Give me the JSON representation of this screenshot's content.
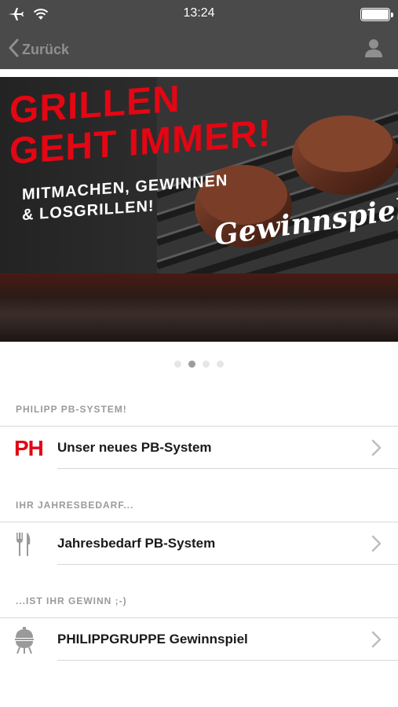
{
  "status_bar": {
    "time": "13:24",
    "icons": [
      "airplane-icon",
      "wifi-icon",
      "battery-icon"
    ]
  },
  "nav": {
    "back_label": "Zurück",
    "user_icon": "user-icon"
  },
  "banner": {
    "headline_line1": "GRILLEN",
    "headline_line2": "GEHT IMMER!",
    "sub_line1": "MITMACHEN, GEWINNEN",
    "sub_line2": "& LOSGRILLEN!",
    "script_text": "Gewinnspiel",
    "accent_color": "#e30613"
  },
  "pager": {
    "count": 4,
    "active_index": 1
  },
  "sections": [
    {
      "header": "PHILIPP PB-SYSTEM!",
      "row_label": "Unser neues PB-System",
      "icon": "ph-logo-icon",
      "icon_text": "PH"
    },
    {
      "header": "IHR JAHRESBEDARF...",
      "row_label": "Jahresbedarf PB-System",
      "icon": "fork-knife-icon"
    },
    {
      "header": "...IST IHR GEWINN ;-)",
      "row_label": "PHILIPPGRUPPE Gewinnspiel",
      "icon": "grill-icon"
    }
  ]
}
